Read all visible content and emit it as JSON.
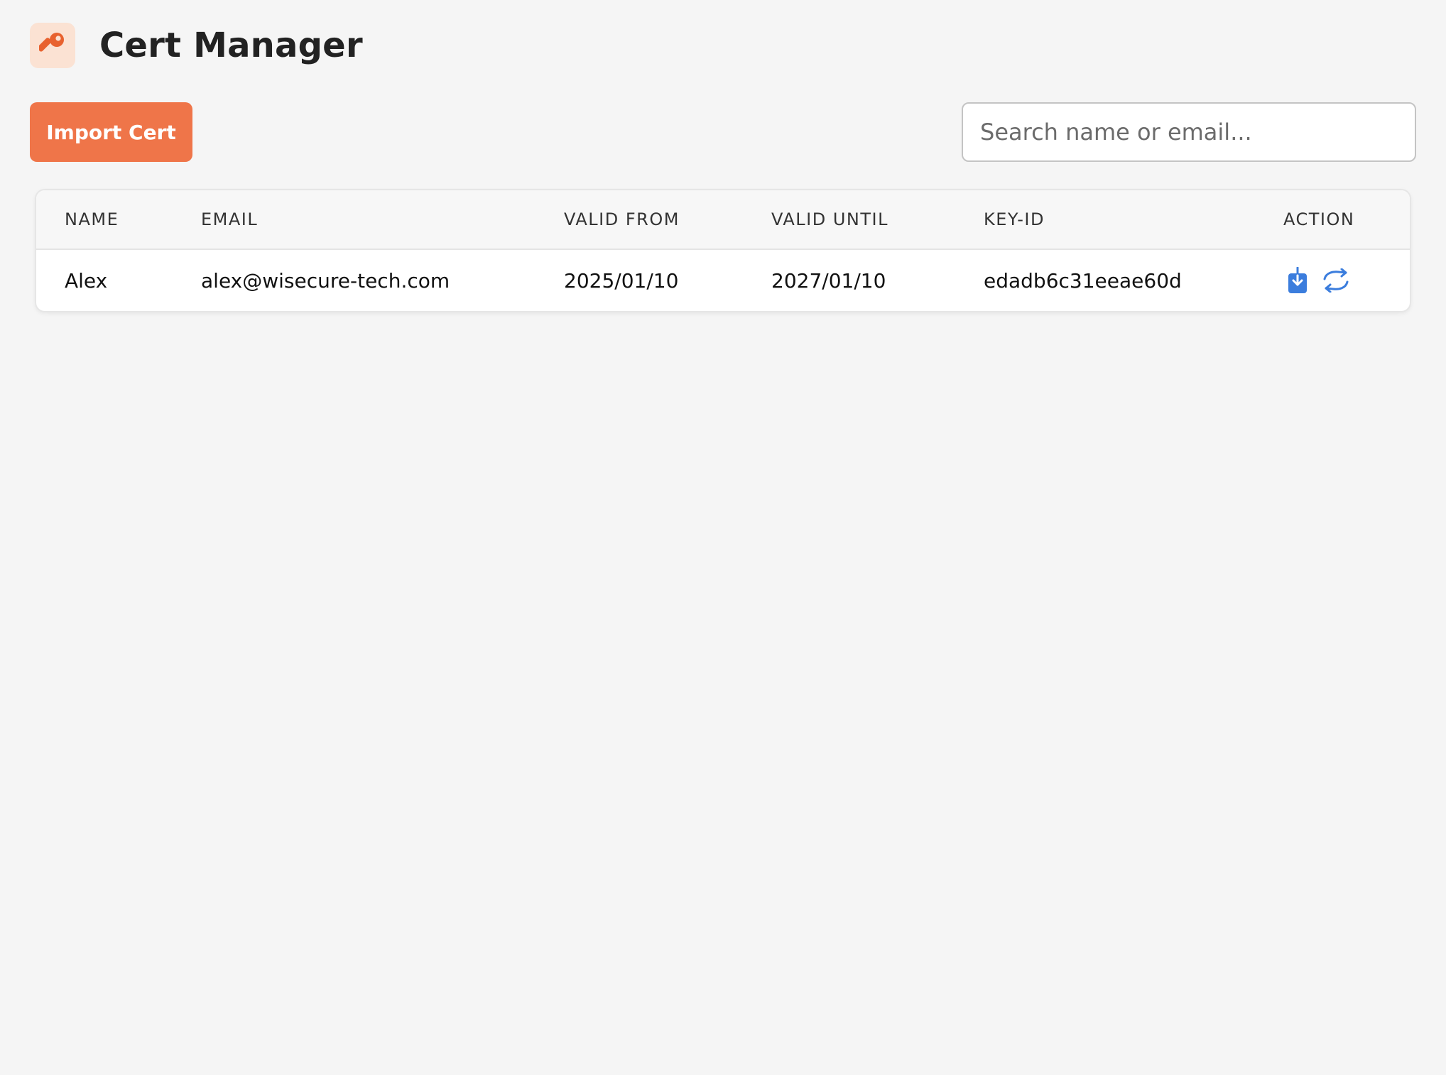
{
  "app": {
    "title": "Cert Manager",
    "logo_icon": "key-icon",
    "accent_color": "#ef7549",
    "logo_color": "#e8622f",
    "action_icon_color": "#3b7ddd"
  },
  "toolbar": {
    "import_label": "Import Cert",
    "search_placeholder": "Search name or email...",
    "search_value": ""
  },
  "table": {
    "columns": [
      "NAME",
      "EMAIL",
      "VALID FROM",
      "VALID UNTIL",
      "KEY-ID",
      "ACTION"
    ],
    "rows": [
      {
        "name": "Alex",
        "email": "alex@wisecure-tech.com",
        "valid_from": "2025/01/10",
        "valid_until": "2027/01/10",
        "key_id": "edadb6c31eeae60d",
        "actions": [
          "download-icon",
          "renew-icon"
        ]
      }
    ]
  }
}
